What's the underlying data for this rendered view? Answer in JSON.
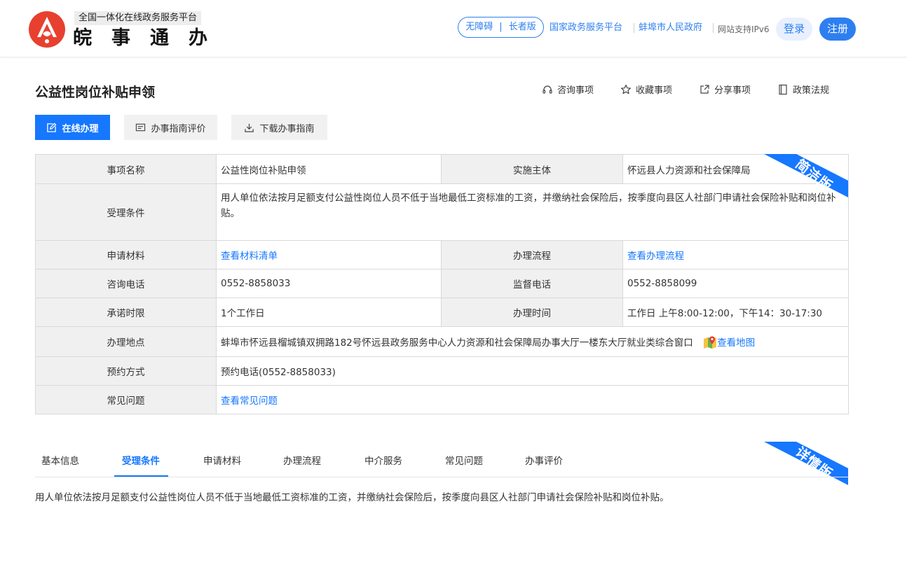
{
  "header": {
    "platform_tag": "全国一体化在线政务服务平台",
    "brand": "皖事通办",
    "accessibility": "无障碍",
    "elder_mode": "长者版",
    "links": [
      "国家政务服务平台",
      "蚌埠市人民政府"
    ],
    "ipv6": "网站支持IPv6",
    "login": "登录",
    "register": "注册"
  },
  "page": {
    "title": "公益性岗位补贴申领",
    "actions": [
      {
        "label": "咨询事项",
        "icon": "headset-icon"
      },
      {
        "label": "收藏事项",
        "icon": "star-icon"
      },
      {
        "label": "分享事项",
        "icon": "share-icon"
      },
      {
        "label": "政策法规",
        "icon": "book-icon"
      }
    ],
    "buttons": {
      "online": "在线办理",
      "evaluate": "办事指南评价",
      "download": "下载办事指南"
    }
  },
  "info": {
    "ribbon": "简洁版",
    "item_name_label": "事项名称",
    "item_name": "公益性岗位补贴申领",
    "subject_label": "实施主体",
    "subject": "怀远县人力资源和社会保障局",
    "condition_label": "受理条件",
    "condition": "用人单位依法按月足额支付公益性岗位人员不低于当地最低工资标准的工资，并缴纳社会保险后，按季度向县区人社部门申请社会保险补贴和岗位补贴。",
    "materials_label": "申请材料",
    "materials_link": "查看材料清单",
    "process_label": "办理流程",
    "process_link": "查看办理流程",
    "phone_label": "咨询电话",
    "phone": "0552-8858033",
    "supervise_label": "监督电话",
    "supervise": "0552-8858099",
    "limit_label": "承诺时限",
    "limit": "1个工作日",
    "hours_label": "办理时间",
    "hours": "工作日 上午8:00-12:00，下午14：30-17:30",
    "address_label": "办理地点",
    "address": "蚌埠市怀远县榴城镇双拥路182号怀远县政务服务中心人力资源和社会保障局办事大厅一楼东大厅就业类综合窗口",
    "map_link": "查看地图",
    "booking_label": "预约方式",
    "booking": "预约电话(0552-8858033)",
    "faq_label": "常见问题",
    "faq_link": "查看常见问题"
  },
  "detail": {
    "ribbon": "详情版",
    "tabs": [
      "基本信息",
      "受理条件",
      "申请材料",
      "办理流程",
      "中介服务",
      "常见问题",
      "办事评价"
    ],
    "active_tab": "受理条件",
    "content": "用人单位依法按月足额支付公益性岗位人员不低于当地最低工资标准的工资，并缴纳社会保险后，按季度向县区人社部门申请社会保险补贴和岗位补贴。"
  },
  "colors": {
    "accent": "#1677ff",
    "brand_red": "#e8402f"
  }
}
